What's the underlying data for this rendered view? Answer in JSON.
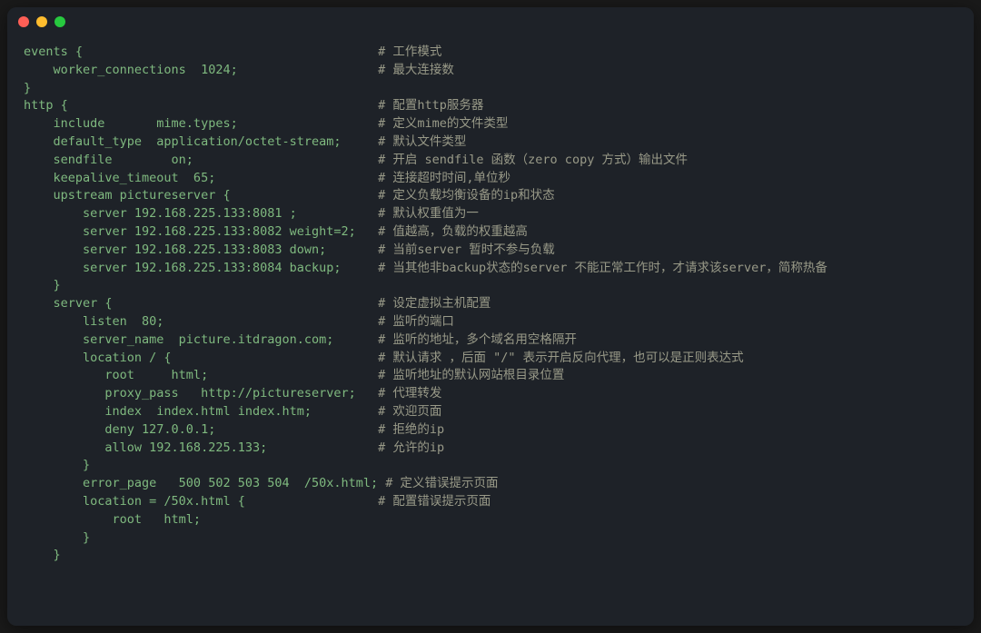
{
  "window": {
    "buttons": {
      "close": "red",
      "minimize": "yellow",
      "maximize": "green"
    }
  },
  "lines": [
    {
      "code": "events {",
      "comment": "# 工作模式"
    },
    {
      "code": "    worker_connections  1024;",
      "comment": "# 最大连接数"
    },
    {
      "code": "}",
      "comment": ""
    },
    {
      "code": "http {",
      "comment": "# 配置http服务器"
    },
    {
      "code": "    include       mime.types;",
      "comment": "# 定义mime的文件类型"
    },
    {
      "code": "    default_type  application/octet-stream;",
      "comment": "# 默认文件类型"
    },
    {
      "code": "    sendfile        on;",
      "comment": "# 开启 sendfile 函数（zero copy 方式）输出文件"
    },
    {
      "code": "    keepalive_timeout  65;",
      "comment": "# 连接超时时间,单位秒"
    },
    {
      "code": "",
      "comment": ""
    },
    {
      "code": "    upstream pictureserver {",
      "comment": "# 定义负载均衡设备的ip和状态"
    },
    {
      "code": "        server 192.168.225.133:8081 ;",
      "comment": "# 默认权重值为一"
    },
    {
      "code": "        server 192.168.225.133:8082 weight=2;",
      "comment": "# 值越高，负载的权重越高"
    },
    {
      "code": "        server 192.168.225.133:8083 down;",
      "comment": "# 当前server 暂时不参与负载"
    },
    {
      "code": "        server 192.168.225.133:8084 backup;",
      "comment": "# 当其他非backup状态的server 不能正常工作时，才请求该server，简称热备"
    },
    {
      "code": "    }",
      "comment": ""
    },
    {
      "code": "    server {",
      "comment": "# 设定虚拟主机配置"
    },
    {
      "code": "        listen  80;",
      "comment": "# 监听的端口"
    },
    {
      "code": "        server_name  picture.itdragon.com;",
      "comment": "# 监听的地址，多个域名用空格隔开"
    },
    {
      "code": "        location / {",
      "comment": "# 默认请求 ，后面 \"/\" 表示开启反向代理，也可以是正则表达式"
    },
    {
      "code": "           root     html;",
      "comment": "# 监听地址的默认网站根目录位置"
    },
    {
      "code": "           proxy_pass   http://pictureserver;",
      "comment": "# 代理转发"
    },
    {
      "code": "           index  index.html index.htm;",
      "comment": "# 欢迎页面"
    },
    {
      "code": "           deny 127.0.0.1;",
      "comment": "# 拒绝的ip"
    },
    {
      "code": "           allow 192.168.225.133;",
      "comment": "# 允许的ip"
    },
    {
      "code": "        }",
      "comment": ""
    },
    {
      "code": "        error_page   500 502 503 504  /50x.html;",
      "comment": "# 定义错误提示页面"
    },
    {
      "code": "        location = /50x.html {",
      "comment": "# 配置错误提示页面"
    },
    {
      "code": "            root   html;",
      "comment": ""
    },
    {
      "code": "        }",
      "comment": ""
    },
    {
      "code": "    }",
      "comment": ""
    }
  ],
  "comment_column": 48
}
